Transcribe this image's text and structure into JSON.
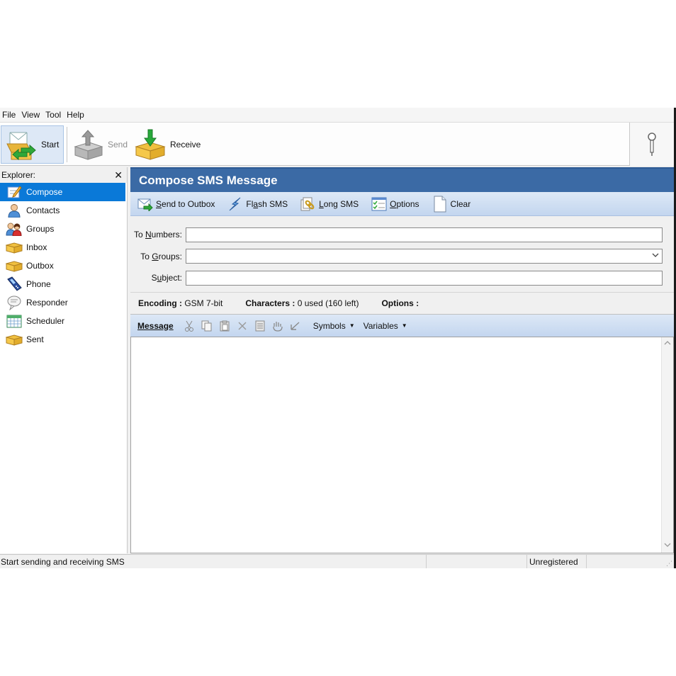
{
  "menu": [
    "File",
    "View",
    "Tool",
    "Help"
  ],
  "toolbar": {
    "start_label": "Start",
    "send_label": "Send",
    "receive_label": "Receive"
  },
  "explorer": {
    "title": "Explorer:",
    "items": [
      {
        "label": "Compose",
        "icon": "compose-icon",
        "active": true
      },
      {
        "label": "Contacts",
        "icon": "contact-icon"
      },
      {
        "label": "Groups",
        "icon": "groups-icon"
      },
      {
        "label": "Inbox",
        "icon": "inbox-icon"
      },
      {
        "label": "Outbox",
        "icon": "outbox-icon"
      },
      {
        "label": "Phone",
        "icon": "phone-icon"
      },
      {
        "label": "Responder",
        "icon": "responder-icon"
      },
      {
        "label": "Scheduler",
        "icon": "scheduler-icon"
      },
      {
        "label": "Sent",
        "icon": "sent-icon"
      }
    ]
  },
  "main": {
    "title": "Compose SMS Message",
    "actions": {
      "send_to_outbox": {
        "pre": "",
        "ul": "S",
        "post": "end to Outbox"
      },
      "flash_sms": {
        "pre": "Fl",
        "ul": "a",
        "post": "sh SMS"
      },
      "long_sms": {
        "pre": "",
        "ul": "L",
        "post": "ong SMS"
      },
      "options": {
        "pre": "",
        "ul": "O",
        "post": "ptions"
      },
      "clear": {
        "pre": "Clear",
        "ul": "",
        "post": ""
      }
    },
    "form": {
      "to_numbers": {
        "pre": "To ",
        "ul": "N",
        "post": "umbers:",
        "value": ""
      },
      "to_groups": {
        "pre": "To ",
        "ul": "G",
        "post": "roups:",
        "value": ""
      },
      "subject": {
        "pre": "S",
        "ul": "u",
        "post": "bject:",
        "value": ""
      }
    },
    "encoding": {
      "encoding_label": "Encoding :",
      "encoding_value": "GSM 7-bit",
      "characters_label": "Characters :",
      "characters_value": "0 used (160 left)",
      "options_label": "Options :"
    },
    "message": {
      "label": "Message",
      "symbols": "Symbols",
      "variables": "Variables",
      "text": ""
    }
  },
  "status": {
    "main": "Start sending and receiving SMS",
    "registration": "Unregistered"
  },
  "colors": {
    "title_bar": "#3b6aa5",
    "selected_item": "#0a79d8",
    "toolbar_gradient_top": "#dde8f6",
    "toolbar_gradient_bottom": "#c3d6ef"
  }
}
